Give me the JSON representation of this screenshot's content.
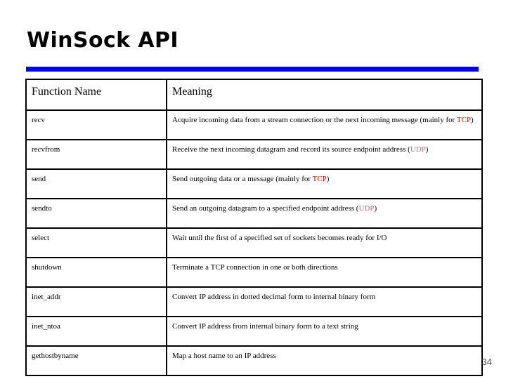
{
  "slide": {
    "title": "WinSock API",
    "page_number": "34",
    "accent_color": "#0000FF",
    "tcp_color": "#E00000",
    "udp_color": "#C06A6A"
  },
  "table": {
    "headers": {
      "function_name": "Function Name",
      "meaning": "Meaning"
    },
    "rows": [
      {
        "function": "recv",
        "meaning_parts": [
          {
            "text": "Acquire incoming data from a stream connection or the next incoming message (mainly for ",
            "style": "plain"
          },
          {
            "text": "TCP",
            "style": "tcp"
          },
          {
            "text": ")",
            "style": "plain"
          }
        ],
        "meaning_plain": "Acquire incoming data from a stream connection or the next incoming message (mainly for TCP)"
      },
      {
        "function": "recvfrom",
        "meaning_parts": [
          {
            "text": "Receive the next incoming datagram and record its source endpoint address (",
            "style": "plain"
          },
          {
            "text": "UDP",
            "style": "udp"
          },
          {
            "text": ")",
            "style": "plain"
          }
        ],
        "meaning_plain": "Receive the next incoming datagram and record its source endpoint address (UDP)"
      },
      {
        "function": "send",
        "meaning_parts": [
          {
            "text": "Send outgoing data or a message (mainly for ",
            "style": "plain"
          },
          {
            "text": "TCP",
            "style": "tcp"
          },
          {
            "text": ")",
            "style": "plain"
          }
        ],
        "meaning_plain": "Send outgoing data or a message (mainly for TCP)"
      },
      {
        "function": "sendto",
        "meaning_parts": [
          {
            "text": "Send an outgoing datagram to a specified endpoint address (",
            "style": "plain"
          },
          {
            "text": "UDP",
            "style": "udp"
          },
          {
            "text": ")",
            "style": "plain"
          }
        ],
        "meaning_plain": "Send an outgoing datagram to a specified endpoint address (UDP)"
      },
      {
        "function": "select",
        "meaning_parts": [
          {
            "text": "Wait until the first of a specified set of sockets becomes ready for I/O",
            "style": "plain"
          }
        ],
        "meaning_plain": "Wait until the first of a specified set of sockets becomes ready for I/O"
      },
      {
        "function": "shutdown",
        "meaning_parts": [
          {
            "text": "Terminate a TCP connection in one or both directions",
            "style": "plain"
          }
        ],
        "meaning_plain": "Terminate a TCP connection in one or both directions"
      },
      {
        "function": "inet_addr",
        "meaning_parts": [
          {
            "text": "Convert IP address in dotted decimal form to internal binary form",
            "style": "plain"
          }
        ],
        "meaning_plain": "Convert IP address in dotted decimal form to internal binary form"
      },
      {
        "function": "inet_ntoa",
        "meaning_parts": [
          {
            "text": "Convert IP address from internal binary form to a text string",
            "style": "plain"
          }
        ],
        "meaning_plain": "Convert IP address from internal binary form to a text string"
      },
      {
        "function": "gethostbyname",
        "meaning_parts": [
          {
            "text": "Map a host name to an IP address",
            "style": "plain"
          }
        ],
        "meaning_plain": "Map a host name to an IP address"
      }
    ]
  }
}
